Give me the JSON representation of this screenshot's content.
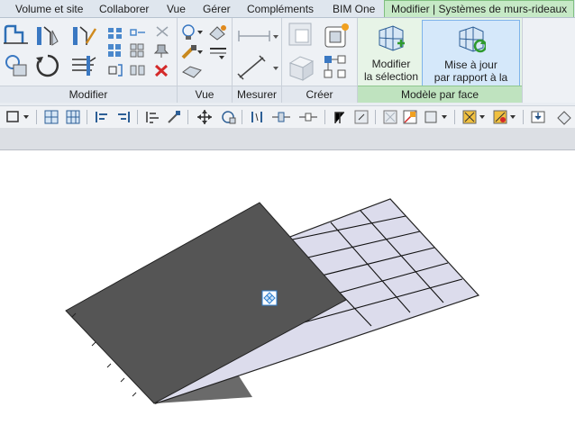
{
  "tabs": {
    "volume": "Volume et site",
    "collaborer": "Collaborer",
    "vue": "Vue",
    "gerer": "Gérer",
    "complements": "Compléments",
    "bimone": "BIM One",
    "context": "Modifier | Systèmes de murs-rideaux"
  },
  "panels": {
    "modifier": "Modifier",
    "vue": "Vue",
    "mesurer": "Mesurer",
    "creer": "Créer",
    "modele_par_face": "Modèle par face"
  },
  "buttons": {
    "modifier_selection_line1": "Modifier",
    "modifier_selection_line2": "la sélection",
    "mise_a_jour_line1": "Mise à jour",
    "mise_a_jour_line2": "par rapport à la face"
  },
  "colors": {
    "context_tab": "#c6e9c6",
    "highlight": "#d5e8fa",
    "ribbon": "#eef1f5",
    "curtain_face": "#dcdcec",
    "mass_face": "#555555"
  },
  "icons": [
    "align-icon",
    "copy-icon",
    "mirror-icon",
    "move-icon",
    "rotate-icon",
    "trim-icon",
    "array-icon",
    "scale-icon",
    "delete-icon",
    "pin-icon",
    "lightbulb-icon",
    "paint-icon",
    "linework-icon",
    "measure-icon",
    "dimension-icon",
    "create-group-icon",
    "create-part-icon",
    "curtain-system-icon",
    "refresh-icon"
  ]
}
